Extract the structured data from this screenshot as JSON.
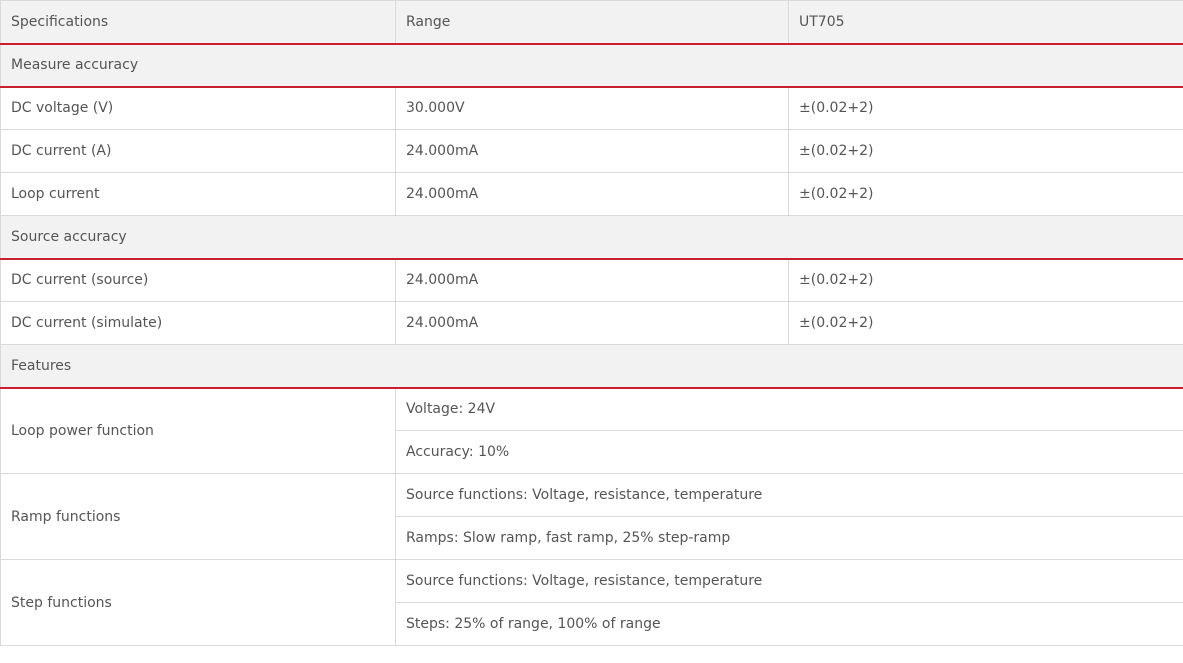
{
  "header": {
    "specifications": "Specifications",
    "range": "Range",
    "model": "UT705"
  },
  "sections": {
    "measure": "Measure accuracy",
    "source": "Source accuracy",
    "features": "Features"
  },
  "measure_rows": [
    {
      "spec": "DC voltage (V)",
      "range": "30.000V",
      "value": "±(0.02+2)"
    },
    {
      "spec": "DC current (A)",
      "range": "24.000mA",
      "value": "±(0.02+2)"
    },
    {
      "spec": "Loop current",
      "range": "24.000mA",
      "value": "±(0.02+2)"
    }
  ],
  "source_rows": [
    {
      "spec": "DC current (source)",
      "range": "24.000mA",
      "value": "±(0.02+2)"
    },
    {
      "spec": "DC current (simulate)",
      "range": "24.000mA",
      "value": "±(0.02+2)"
    }
  ],
  "features": [
    {
      "name": "Loop power function",
      "details": [
        "Voltage: 24V",
        "Accuracy: 10%"
      ]
    },
    {
      "name": "Ramp functions",
      "details": [
        "Source functions: Voltage, resistance, temperature",
        "Ramps: Slow ramp, fast ramp, 25% step-ramp"
      ]
    },
    {
      "name": "Step functions",
      "details": [
        "Source functions: Voltage, resistance, temperature",
        "Steps: 25% of range, 100% of range"
      ]
    }
  ],
  "colors": {
    "accent": "#c8202f",
    "header_bg": "#f2f2f2",
    "border": "#d9d9d9",
    "text": "#555555"
  }
}
